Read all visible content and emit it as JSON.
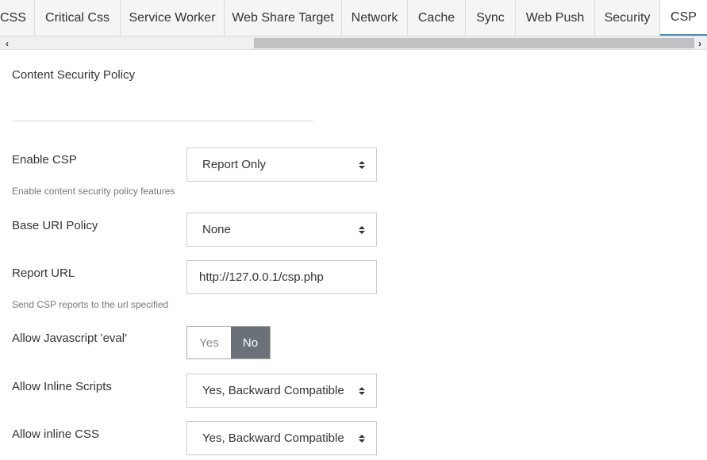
{
  "tabs": [
    {
      "label": "CSS"
    },
    {
      "label": "Critical Css"
    },
    {
      "label": "Service Worker"
    },
    {
      "label": "Web Share Target"
    },
    {
      "label": "Network"
    },
    {
      "label": "Cache"
    },
    {
      "label": "Sync"
    },
    {
      "label": "Web Push"
    },
    {
      "label": "Security"
    },
    {
      "label": "CSP"
    }
  ],
  "active_tab": "CSP",
  "section": {
    "title": "Content Security Policy"
  },
  "fields": {
    "enable_csp": {
      "label": "Enable CSP",
      "value": "Report Only",
      "help": "Enable content security policy features"
    },
    "base_uri": {
      "label": "Base URI Policy",
      "value": "None"
    },
    "report_url": {
      "label": "Report URL",
      "value": "http://127.0.0.1/csp.php",
      "help": "Send CSP reports to the url specified"
    },
    "allow_eval": {
      "label": "Allow Javascript 'eval'",
      "yes": "Yes",
      "no": "No",
      "selected": "No"
    },
    "inline_scripts": {
      "label": "Allow Inline Scripts",
      "value": "Yes, Backward Compatible"
    },
    "inline_css": {
      "label": "Allow inline CSS",
      "value": "Yes, Backward Compatible"
    }
  },
  "colors": {
    "accent": "#4a8fb8",
    "toggle_active": "#6a7178"
  }
}
